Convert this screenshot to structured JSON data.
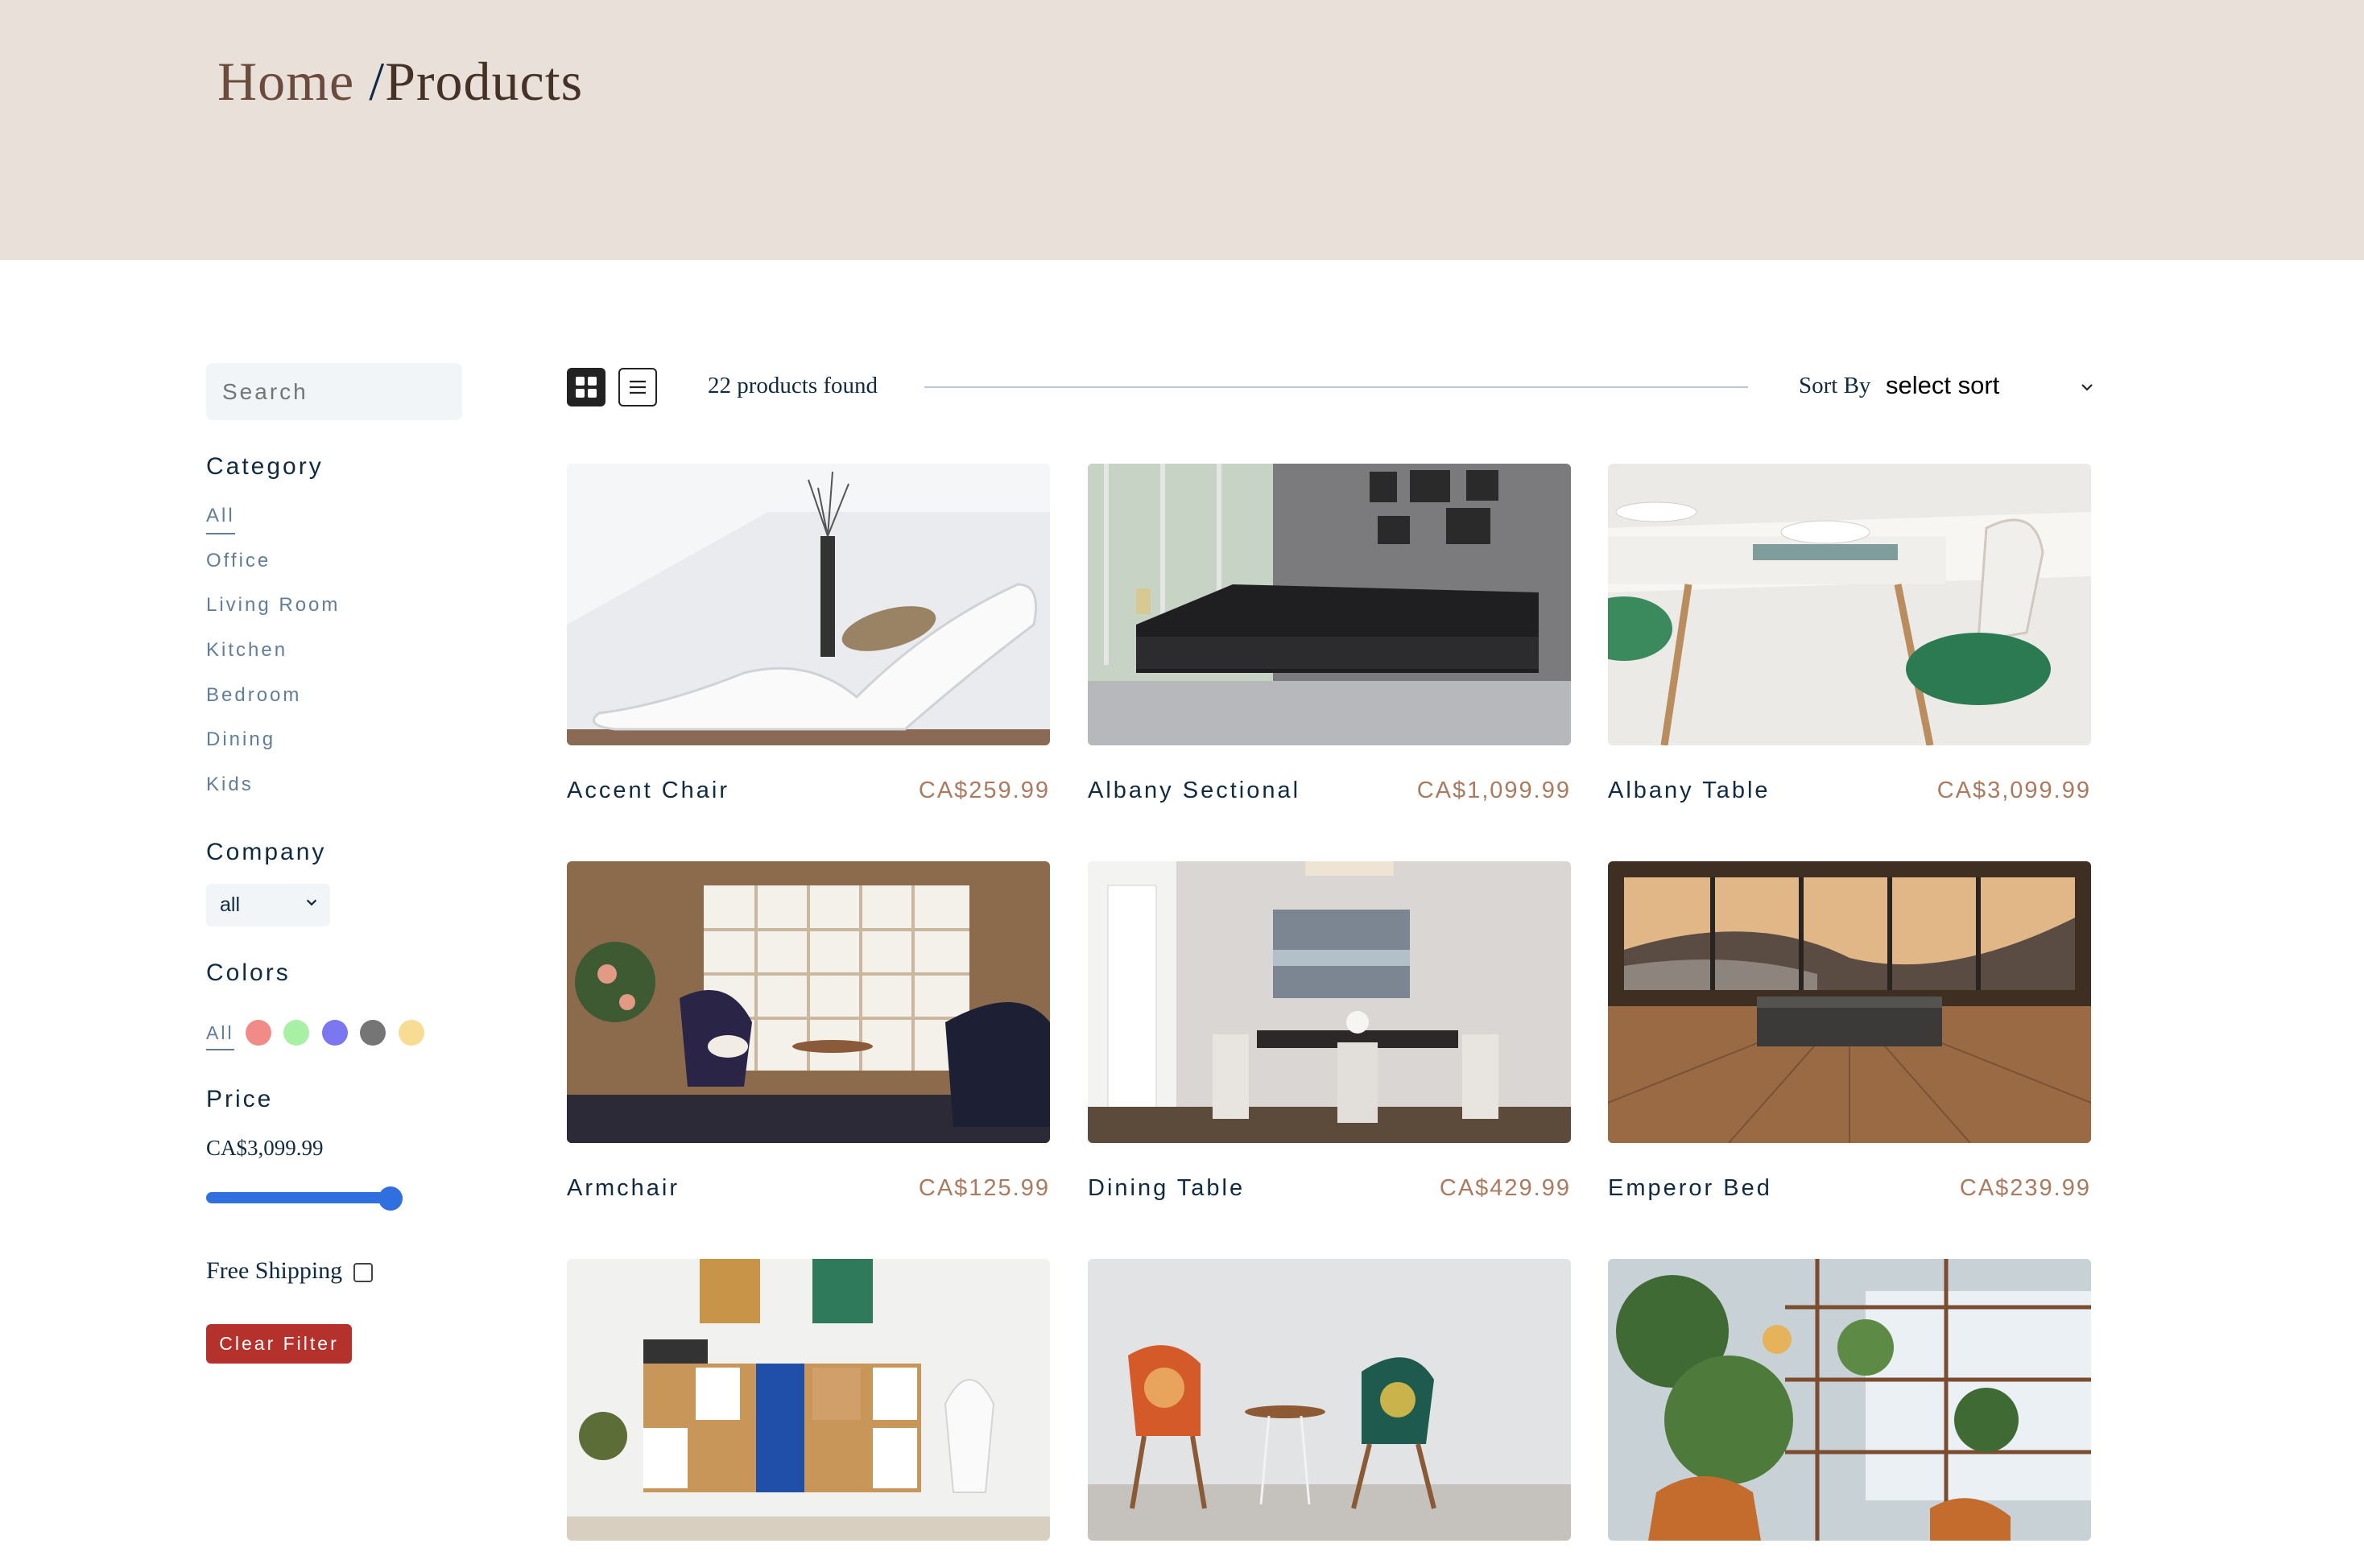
{
  "breadcrumb": {
    "home": "Home",
    "separator": "/",
    "current": "Products"
  },
  "search": {
    "placeholder": "Search"
  },
  "filters": {
    "category_title": "Category",
    "categories": [
      "All",
      "Office",
      "Living Room",
      "Kitchen",
      "Bedroom",
      "Dining",
      "Kids"
    ],
    "active_category": "All",
    "company_title": "Company",
    "company_selected": "all",
    "colors_title": "Colors",
    "colors_all": "All",
    "colors": [
      "#f08b88",
      "#a8f0a4",
      "#7a77f0",
      "#757575",
      "#f8dc94"
    ],
    "price_title": "Price",
    "price_value": "CA$3,099.99",
    "price_slider_fraction": 1.0,
    "shipping_label": "Free Shipping",
    "shipping_checked": false,
    "clear_label": "Clear Filter"
  },
  "toolbar": {
    "found_text": "22 products found",
    "sort_label": "Sort By",
    "sort_selected": "select sort",
    "view_mode": "grid"
  },
  "products": [
    {
      "name": "Accent Chair",
      "price": "CA$259.99",
      "image": "white-lounge-chair-photo"
    },
    {
      "name": "Albany Sectional",
      "price": "CA$1,099.99",
      "image": "black-sectional-sofa-photo"
    },
    {
      "name": "Albany Table",
      "price": "CA$3,099.99",
      "image": "dining-table-setting-photo"
    },
    {
      "name": "Armchair",
      "price": "CA$125.99",
      "image": "armchairs-bookshelf-photo"
    },
    {
      "name": "Dining Table",
      "price": "CA$429.99",
      "image": "dining-room-photo"
    },
    {
      "name": "Emperor Bed",
      "price": "CA$239.99",
      "image": "bedroom-mountain-view-photo"
    },
    {
      "name": "",
      "price": "",
      "image": "cabinet-shelving-photo"
    },
    {
      "name": "",
      "price": "",
      "image": "patterned-chairs-photo"
    },
    {
      "name": "",
      "price": "",
      "image": "plants-shelf-photo"
    }
  ]
}
